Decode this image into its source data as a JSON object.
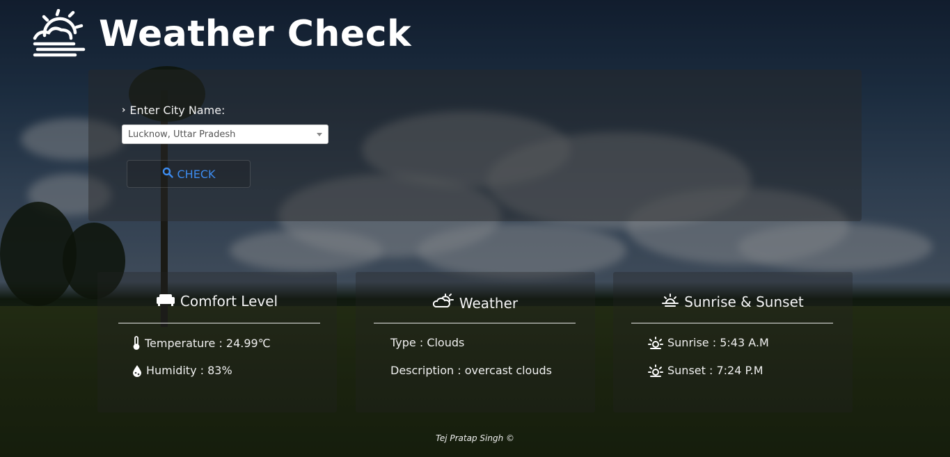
{
  "header": {
    "title": "Weather Check",
    "logo_icon": "sun-behind-clouds-icon"
  },
  "search": {
    "label": "Enter City Name:",
    "selected_city": "Lucknow, Uttar Pradesh",
    "check_label": "CHECK"
  },
  "cards": {
    "comfort": {
      "title": "Comfort Level",
      "temperature": "Temperature : 24.99℃",
      "humidity": "Humidity : 83%"
    },
    "weather": {
      "title": "Weather",
      "type": "Type : Clouds",
      "description": "Description : overcast clouds"
    },
    "sun": {
      "title": "Sunrise & Sunset",
      "sunrise": "Sunrise : 5:43 A.M",
      "sunset": "Sunset : 7:24 P.M"
    }
  },
  "footer": {
    "credit": "Tej Pratap Singh ©"
  },
  "colors": {
    "accent_button_text": "#3d8cf0",
    "text": "#ffffff"
  }
}
